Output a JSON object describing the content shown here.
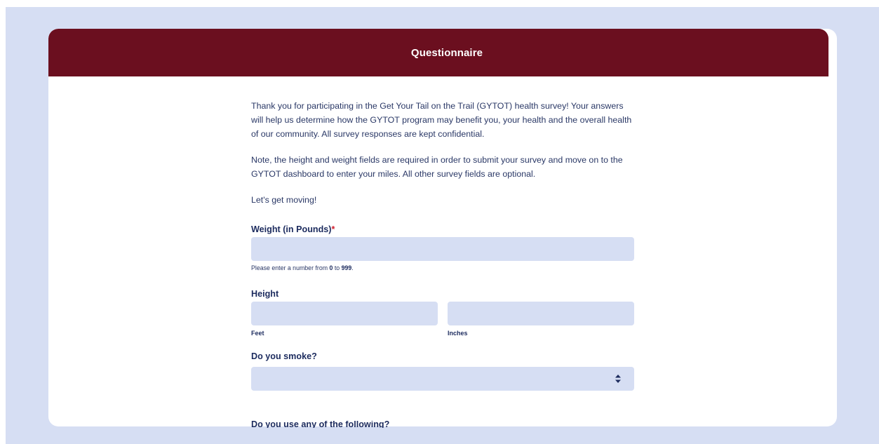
{
  "header": {
    "title": "Questionnaire"
  },
  "intro": {
    "paragraph1": "Thank you for participating in the Get Your Tail on the Trail (GYTOT) health survey! Your answers will help us determine how the GYTOT program may benefit you, your health and the overall health of our community. All survey responses are kept confidential.",
    "paragraph2": "Note, the height and weight fields are required in order to submit your survey and move on to the GYTOT dashboard to enter your miles. All other survey fields are optional.",
    "paragraph3": "Let's get moving!"
  },
  "weight": {
    "label": "Weight (in Pounds)",
    "required_mark": "*",
    "value": "",
    "hint_prefix": "Please enter a number from ",
    "hint_min": "0",
    "hint_mid": " to ",
    "hint_max": "999",
    "hint_suffix": "."
  },
  "height": {
    "label": "Height",
    "feet_label": "Feet",
    "inches_label": "Inches",
    "feet_value": "",
    "inches_value": ""
  },
  "smoke": {
    "label": "Do you smoke?",
    "selected": ""
  },
  "next_question": {
    "label": "Do you use any of the following?"
  },
  "colors": {
    "page_background": "#d6def3",
    "header_background": "#6b0f1f",
    "input_background": "#d6def3",
    "text": "#1c2b5e",
    "required": "#d0202e"
  }
}
